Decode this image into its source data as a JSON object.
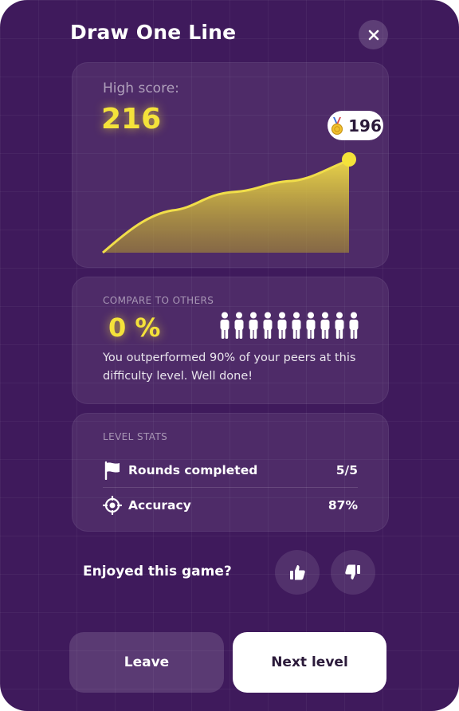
{
  "header": {
    "title": "Draw One Line",
    "close_icon": "close-icon"
  },
  "high_score": {
    "label": "High score:",
    "value": "216",
    "best_badge": {
      "icon": "medal-icon",
      "value": "196"
    }
  },
  "compare": {
    "section_label": "COMPARE TO OTHERS",
    "percentile": "0 %",
    "people_count": 10,
    "people_icon": "person-icon",
    "message": "You outperformed 90% of your peers at this difficulty level. Well done!"
  },
  "level_stats": {
    "section_label": "LEVEL STATS",
    "rows": [
      {
        "icon": "flag-icon",
        "label": "Rounds completed",
        "value": "5/5"
      },
      {
        "icon": "target-icon",
        "label": "Accuracy",
        "value": "87%"
      }
    ]
  },
  "feedback": {
    "question": "Enjoyed this game?",
    "like_icon": "thumbs-up-icon",
    "dislike_icon": "thumbs-down-icon"
  },
  "actions": {
    "leave_label": "Leave",
    "next_label": "Next level"
  },
  "colors": {
    "background": "#3f1a5c",
    "accent": "#f4e23a",
    "button_light": "#ffffff"
  }
}
